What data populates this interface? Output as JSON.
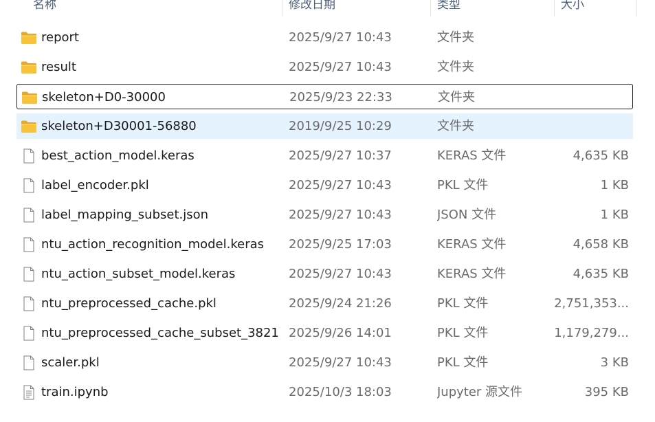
{
  "columns": {
    "name": "名称",
    "date": "修改日期",
    "type": "类型",
    "size": "大小"
  },
  "rows": [
    {
      "name": "report",
      "date": "2025/9/27 10:43",
      "type": "文件夹",
      "size": "",
      "icon": "folder-icon"
    },
    {
      "name": "result",
      "date": "2025/9/27 10:43",
      "type": "文件夹",
      "size": "",
      "icon": "folder-icon"
    },
    {
      "name": "skeleton+D0-30000",
      "date": "2025/9/23 22:33",
      "type": "文件夹",
      "size": "",
      "icon": "folder-icon",
      "state": "focused"
    },
    {
      "name": "skeleton+D30001-56880",
      "date": "2019/9/25 10:29",
      "type": "文件夹",
      "size": "",
      "icon": "folder-icon",
      "state": "selected"
    },
    {
      "name": "best_action_model.keras",
      "date": "2025/9/27 10:37",
      "type": "KERAS 文件",
      "size": "4,635 KB",
      "icon": "file-icon"
    },
    {
      "name": "label_encoder.pkl",
      "date": "2025/9/27 10:43",
      "type": "PKL 文件",
      "size": "1 KB",
      "icon": "file-icon"
    },
    {
      "name": "label_mapping_subset.json",
      "date": "2025/9/27 10:43",
      "type": "JSON 文件",
      "size": "1 KB",
      "icon": "file-icon"
    },
    {
      "name": "ntu_action_recognition_model.keras",
      "date": "2025/9/25 17:03",
      "type": "KERAS 文件",
      "size": "4,658 KB",
      "icon": "file-icon"
    },
    {
      "name": "ntu_action_subset_model.keras",
      "date": "2025/9/27 10:43",
      "type": "KERAS 文件",
      "size": "4,635 KB",
      "icon": "file-icon"
    },
    {
      "name": "ntu_preprocessed_cache.pkl",
      "date": "2025/9/24 21:26",
      "type": "PKL 文件",
      "size": "2,751,353...",
      "icon": "file-icon"
    },
    {
      "name": "ntu_preprocessed_cache_subset_3821...",
      "date": "2025/9/26 14:01",
      "type": "PKL 文件",
      "size": "1,179,279...",
      "icon": "file-icon"
    },
    {
      "name": "scaler.pkl",
      "date": "2025/9/27 10:43",
      "type": "PKL 文件",
      "size": "3 KB",
      "icon": "file-icon"
    },
    {
      "name": "train.ipynb",
      "date": "2025/10/3 18:03",
      "type": "Jupyter 源文件",
      "size": "395 KB",
      "icon": "notebook-file-icon"
    }
  ],
  "colors": {
    "selected_row": "#e5f3ff",
    "focus_border": "#1c1c1c",
    "folder_yellow": "#f8c33b"
  }
}
